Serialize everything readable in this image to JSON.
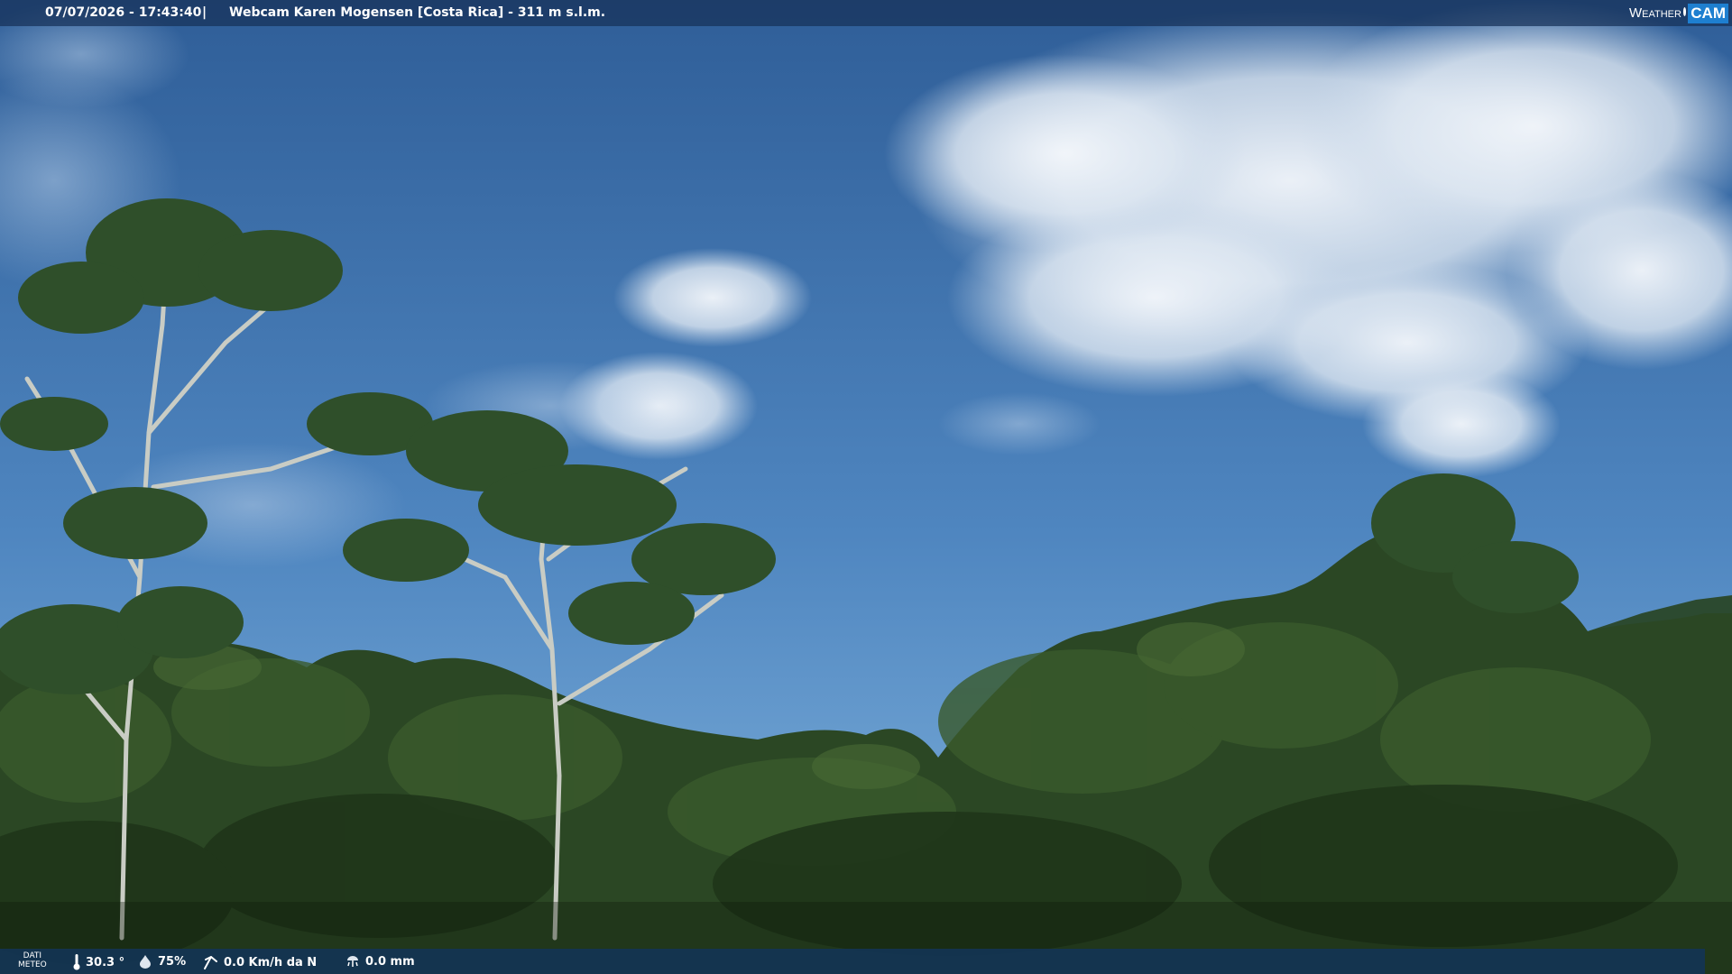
{
  "overlay": {
    "timestamp": "07/07/2026 - 17:43:40",
    "separator": "|",
    "camera_title": "Webcam Karen Mogensen [Costa Rica]  - 311 m s.l.m.",
    "logo_word": "Weather",
    "logo_cam": "CAM"
  },
  "weather": {
    "label_line1": "DATI",
    "label_line2": "METEO",
    "temperature": "30.3 °",
    "humidity": "75%",
    "wind": "0.0 Km/h da N",
    "rain": "0.0 mm"
  },
  "icons": {
    "temperature": "thermometer-icon",
    "humidity": "humidity-drop-icon",
    "wind": "wind-icon",
    "rain": "rain-gauge-icon"
  },
  "colors": {
    "sky_top": "#2f5f9a",
    "sky_bottom": "#6a9fd2",
    "forest": "#26401f"
  }
}
